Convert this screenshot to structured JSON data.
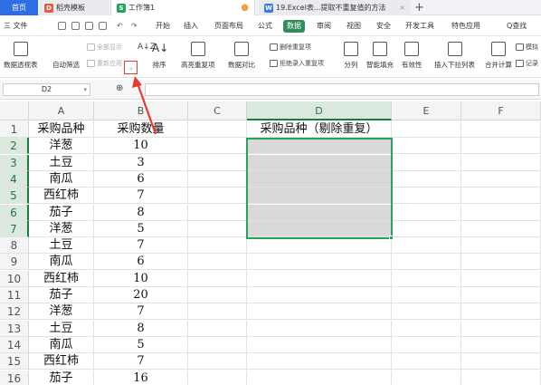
{
  "tabs": [
    {
      "label": "首页",
      "icon": "home-icon"
    },
    {
      "label": "稻壳模板",
      "icon": "docer-icon",
      "color": "#e85a3b"
    },
    {
      "label": "工作簿1",
      "icon": "sheet-icon",
      "color": "#21a35a"
    },
    {
      "label": "19.Excel表...提取不重复值的方法",
      "icon": "word-icon",
      "color": "#3b79e5"
    }
  ],
  "menu": {
    "file": "三 文件",
    "items": [
      "开始",
      "插入",
      "页面布局",
      "公式",
      "数据",
      "审阅",
      "视图",
      "安全",
      "开发工具",
      "特色应用"
    ],
    "active": "数据",
    "search": "Q查找"
  },
  "ribbon": {
    "pivot": "数据透视表",
    "autofilter": "自动筛选",
    "show_all": "全部显示",
    "reapply": "重新应用",
    "sort": "排序",
    "highlight_dup": "高亮重复项",
    "compare": "数据对比",
    "remove_dup": "删除重复项",
    "reject_dup": "拒绝录入重复项",
    "split": "分列",
    "fill": "智能填充",
    "validity": "有效性",
    "dropdown": "插入下拉列表",
    "consolidate": "合并计算",
    "simulate": "模拟",
    "record": "记录"
  },
  "name_box": "D2",
  "columns": [
    "A",
    "B",
    "C",
    "D",
    "E",
    "F"
  ],
  "rows": [
    "1",
    "2",
    "3",
    "4",
    "5",
    "6",
    "7",
    "8",
    "9",
    "10",
    "11",
    "12",
    "13",
    "14",
    "15",
    "16"
  ],
  "headers": {
    "a": "采购品种",
    "b": "采购数量",
    "d": "采购品种（剔除重复）"
  },
  "data": [
    [
      "洋葱",
      "10"
    ],
    [
      "土豆",
      "3"
    ],
    [
      "南瓜",
      "6"
    ],
    [
      "西红柿",
      "7"
    ],
    [
      "茄子",
      "8"
    ],
    [
      "洋葱",
      "5"
    ],
    [
      "土豆",
      "7"
    ],
    [
      "南瓜",
      "6"
    ],
    [
      "西红柿",
      "10"
    ],
    [
      "茄子",
      "20"
    ],
    [
      "洋葱",
      "7"
    ],
    [
      "土豆",
      "8"
    ],
    [
      "南瓜",
      "5"
    ],
    [
      "西红柿",
      "7"
    ],
    [
      "茄子",
      "16"
    ]
  ],
  "colors": {
    "accent": "#2f8d5a",
    "selection": "#27a35a",
    "annotation": "#e63b2e"
  }
}
